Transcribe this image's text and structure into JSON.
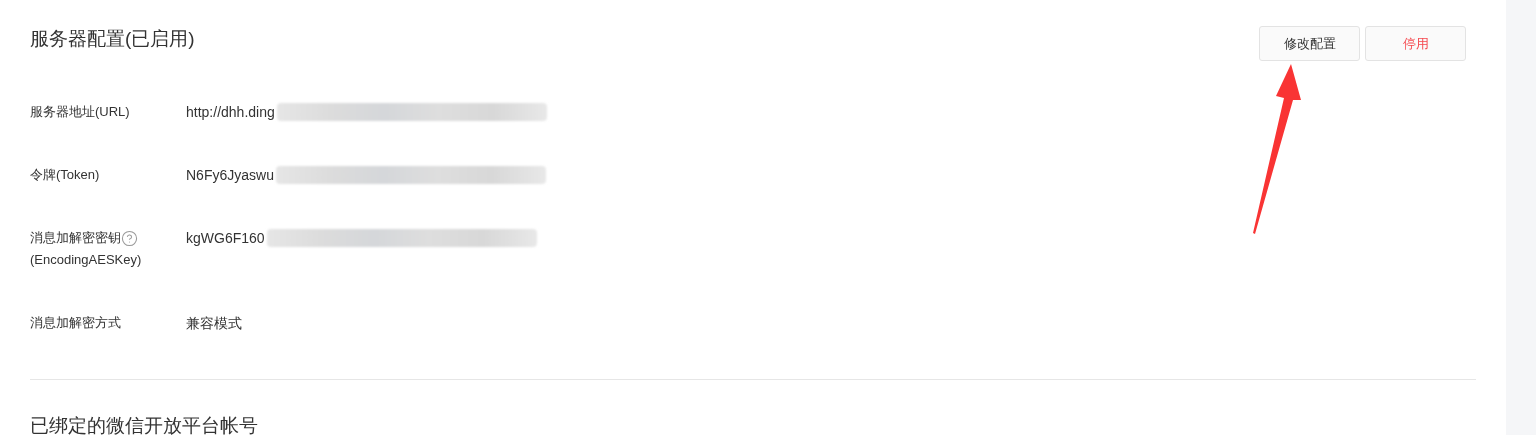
{
  "section": {
    "title": "服务器配置(已启用)"
  },
  "buttons": [
    {
      "label": "修改配置",
      "kind": "default"
    },
    {
      "label": "停用",
      "kind": "danger"
    }
  ],
  "fields": [
    {
      "label": "服务器地址(URL)",
      "value": "http://dhh.ding",
      "redacted": true,
      "help": false
    },
    {
      "label": "令牌(Token)",
      "value": "N6Fy6Jyaswu",
      "redacted": true,
      "help": false
    },
    {
      "label": "消息加解密密钥",
      "sublabel": "(EncodingAESKey)",
      "value": "kgWG6F160",
      "redacted": true,
      "help": true
    },
    {
      "label": "消息加解密方式",
      "value": "兼容模式",
      "redacted": false,
      "help": false
    }
  ],
  "bound_section": {
    "title": "已绑定的微信开放平台帐号"
  }
}
